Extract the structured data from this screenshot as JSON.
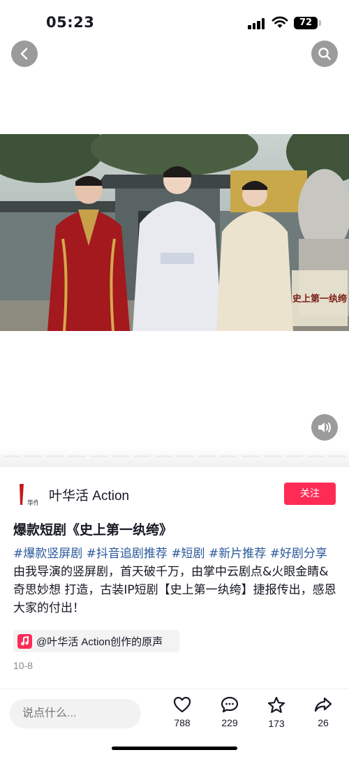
{
  "status_bar": {
    "time": "05:23",
    "battery": "72"
  },
  "video": {
    "overlay_text": "史上第一纨绔"
  },
  "author": {
    "name": "叶华活 Action",
    "avatar_text": "华作",
    "follow_label": "关注"
  },
  "post": {
    "title": "爆款短剧《史上第一纨绔》",
    "tags": [
      "#爆款竖屏剧",
      "#抖音追剧推荐",
      "#短剧",
      "#新片推荐",
      "#好剧分享"
    ],
    "body": " 由我导演的竖屏剧，首天破千万，由掌中云剧点&火眼金睛&奇思妙想 打造，古装IP短剧【史上第一纨绔】捷报传出，感恩大家的付出！"
  },
  "music": {
    "label": "@叶华活 Action创作的原声"
  },
  "date": "10-8",
  "comment": {
    "placeholder": "说点什么..."
  },
  "actions": {
    "like": {
      "count": "788",
      "icon": "heart-icon"
    },
    "comment": {
      "count": "229",
      "icon": "comment-icon"
    },
    "favorite": {
      "count": "173",
      "icon": "star-icon"
    },
    "share": {
      "count": "26",
      "icon": "share-icon"
    }
  },
  "colors": {
    "accent": "#fe2c55",
    "tag": "#2b5a9b",
    "text": "#161823",
    "muted": "#8a8b91"
  }
}
